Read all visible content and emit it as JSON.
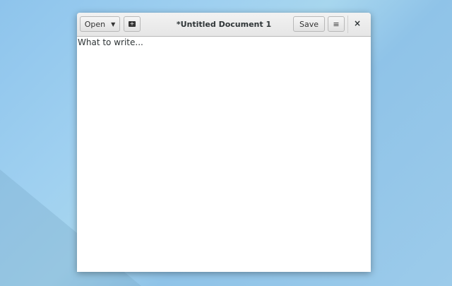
{
  "window": {
    "title": "*Untitled Document 1",
    "open_label": "Open",
    "save_label": "Save",
    "close_label": "×",
    "menu_label": "≡"
  },
  "editor": {
    "content": "What to write..."
  }
}
